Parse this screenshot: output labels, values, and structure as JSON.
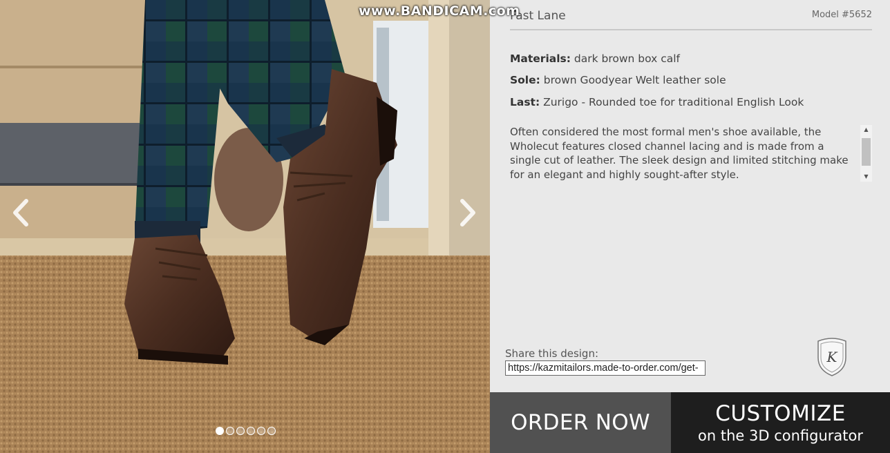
{
  "watermark": "www.BANDICAM.com",
  "gallery": {
    "prev_icon": "chevron-left-icon",
    "next_icon": "chevron-right-icon",
    "slide_count": 6,
    "active_slide": 1
  },
  "product": {
    "name": "Fast Lane",
    "model": "Model #5652",
    "specs": [
      {
        "label": "Materials:",
        "value": " dark brown box calf"
      },
      {
        "label": "Sole:",
        "value": " brown Goodyear Welt leather sole"
      },
      {
        "label": "Last:",
        "value": " Zurigo - Rounded toe for traditional English Look"
      }
    ],
    "description": "Often considered the most formal men's shoe available, the Wholecut features closed channel lacing and is made from a single cut of leather. The sleek design and limited stitching make for an elegant and highly sought-after style."
  },
  "share": {
    "label": "Share this design:",
    "url": "https://kazmitailors.made-to-order.com/get-"
  },
  "logo": {
    "letter": "K"
  },
  "buttons": {
    "order": "ORDER NOW",
    "customize_line1": "CUSTOMIZE",
    "customize_line2": "on the 3D configurator"
  },
  "colors": {
    "order_bg": "#515151",
    "customize_bg": "#1e1e1e",
    "panel_bg": "#e9e9e9"
  }
}
